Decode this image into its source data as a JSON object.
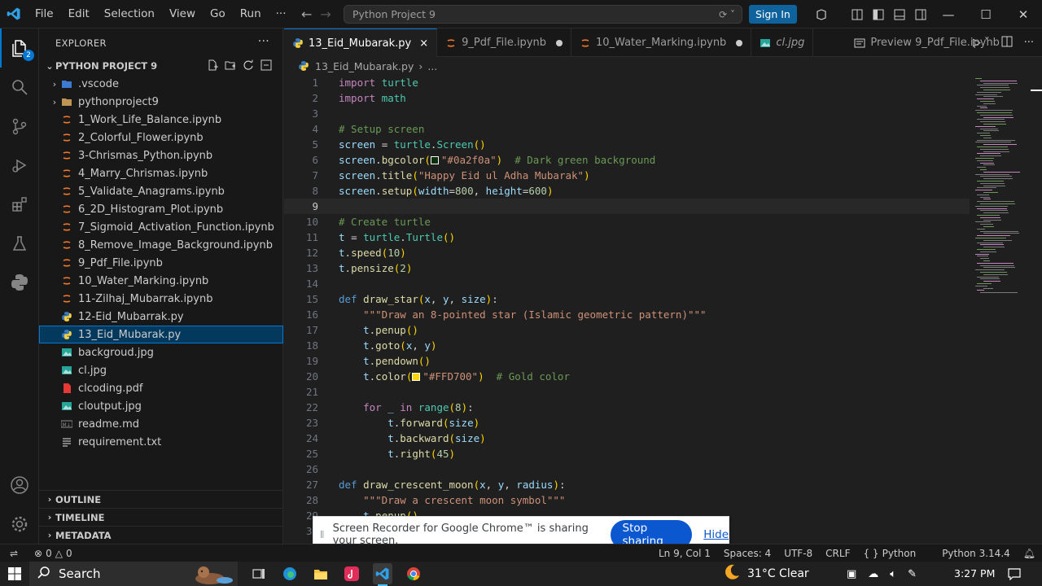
{
  "titlebar": {
    "menu": [
      "File",
      "Edit",
      "Selection",
      "View",
      "Go",
      "Run",
      "···"
    ],
    "search_text": "Python Project 9",
    "sign_in": "Sign In"
  },
  "activity": {
    "explorer_badge": "2"
  },
  "sidebar": {
    "header": "EXPLORER",
    "project": "PYTHON PROJECT 9",
    "items": [
      {
        "name": ".vscode",
        "type": "folder-vscode"
      },
      {
        "name": "pythonproject9",
        "type": "folder"
      },
      {
        "name": "1_Work_Life_Balance.ipynb",
        "type": "notebook"
      },
      {
        "name": "2_Colorful_Flower.ipynb",
        "type": "notebook"
      },
      {
        "name": "3-Chrismas_Python.ipynb",
        "type": "notebook"
      },
      {
        "name": "4_Marry_Chrismas.ipynb",
        "type": "notebook"
      },
      {
        "name": "5_Validate_Anagrams.ipynb",
        "type": "notebook"
      },
      {
        "name": "6_2D_Histogram_Plot.ipynb",
        "type": "notebook"
      },
      {
        "name": "7_Sigmoid_Activation_Function.ipynb",
        "type": "notebook"
      },
      {
        "name": "8_Remove_Image_Background.ipynb",
        "type": "notebook"
      },
      {
        "name": "9_Pdf_File.ipynb",
        "type": "notebook"
      },
      {
        "name": "10_Water_Marking.ipynb",
        "type": "notebook"
      },
      {
        "name": "11-Zilhaj_Mubarrak.ipynb",
        "type": "notebook"
      },
      {
        "name": "12-Eid_Mubarrak.py",
        "type": "python"
      },
      {
        "name": "13_Eid_Mubarak.py",
        "type": "python",
        "selected": true
      },
      {
        "name": "backgroud.jpg",
        "type": "image"
      },
      {
        "name": "cl.jpg",
        "type": "image"
      },
      {
        "name": "clcoding.pdf",
        "type": "pdf"
      },
      {
        "name": "cloutput.jpg",
        "type": "image"
      },
      {
        "name": "readme.md",
        "type": "markdown"
      },
      {
        "name": "requirement.txt",
        "type": "text"
      }
    ],
    "sections": [
      "OUTLINE",
      "TIMELINE",
      "METADATA"
    ]
  },
  "tabs": [
    {
      "label": "13_Eid_Mubarak.py",
      "icon": "python-icon",
      "active": true,
      "close": "×"
    },
    {
      "label": "9_Pdf_File.ipynb",
      "icon": "notebook-icon",
      "dirty": true
    },
    {
      "label": "10_Water_Marking.ipynb",
      "icon": "notebook-icon",
      "dirty": true
    },
    {
      "label": "cl.jpg",
      "icon": "image-icon",
      "italic": true
    },
    {
      "label": "Preview 9_Pdf_File.ipynb",
      "icon": "preview-icon"
    }
  ],
  "breadcrumb": {
    "file": "13_Eid_Mubarak.py",
    "sep": "›",
    "more": "..."
  },
  "code": {
    "current_line": 9,
    "lines": [
      "import turtle",
      "import math",
      "",
      "# Setup screen",
      "screen = turtle.Screen()",
      "screen.bgcolor(\"#0a2f0a\")  # Dark green background",
      "screen.title(\"Happy Eid ul Adha Mubarak\")",
      "screen.setup(width=800, height=600)",
      "",
      "# Create turtle",
      "t = turtle.Turtle()",
      "t.speed(10)",
      "t.pensize(2)",
      "",
      "def draw_star(x, y, size):",
      "    \"\"\"Draw an 8-pointed star (Islamic geometric pattern)\"\"\"",
      "    t.penup()",
      "    t.goto(x, y)",
      "    t.pendown()",
      "    t.color(\"#FFD700\")  # Gold color",
      "",
      "    for _ in range(8):",
      "        t.forward(size)",
      "        t.backward(size)",
      "        t.right(45)",
      "",
      "def draw_crescent_moon(x, y, radius):",
      "    \"\"\"Draw a crescent moon symbol\"\"\"",
      "    t.penup()",
      ""
    ],
    "swatch_colors": {
      "bg": "#0a2f0a",
      "gold": "#FFD700"
    }
  },
  "share": {
    "text": "Screen Recorder for Google Chrome™ is sharing your screen.",
    "stop": "Stop sharing",
    "hide": "Hide"
  },
  "statusbar": {
    "errors": "0",
    "warnings": "0",
    "position": "Ln 9, Col 1",
    "spaces": "Spaces: 4",
    "encoding": "UTF-8",
    "eol": "CRLF",
    "language": "Python",
    "interpreter": "Python 3.14.4"
  },
  "taskbar": {
    "search": "Search",
    "weather": "31°C  Clear",
    "time": "3:27 PM"
  }
}
